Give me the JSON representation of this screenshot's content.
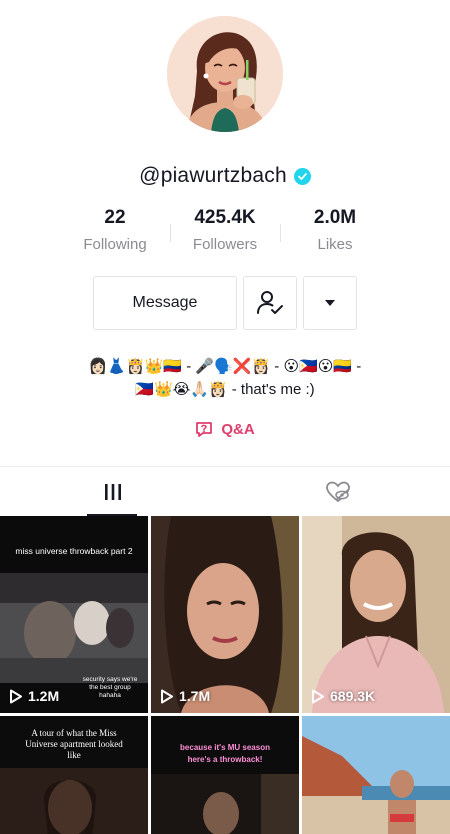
{
  "profile": {
    "username": "@piawurtzbach",
    "verified": true,
    "stats": [
      {
        "value": "22",
        "label": "Following"
      },
      {
        "value": "425.4K",
        "label": "Followers"
      },
      {
        "value": "2.0M",
        "label": "Likes"
      }
    ]
  },
  "actions": {
    "message_label": "Message"
  },
  "bio": {
    "line1": "👩🏻👗👸🏻👑🇨🇴 - 🎤🗣️❌👸🏻 - 😮🇵🇭😮🇨🇴 -",
    "line2": "🇵🇭👑😭🙏🏻👸🏻 - that's me :)"
  },
  "qa_label": "Q&A",
  "tabs": [
    {
      "icon": "grid-icon",
      "active": true
    },
    {
      "icon": "liked-hidden-icon",
      "active": false
    }
  ],
  "videos": [
    {
      "views": "1.2M",
      "caption_top": "miss universe throwback part 2",
      "caption_bottom": "security says we're the best group hahaha"
    },
    {
      "views": "1.7M"
    },
    {
      "views": "689.3K"
    },
    {
      "caption_top": "A tour of what the Miss Universe apartment looked like"
    },
    {
      "caption_top": "because it's MU season here's a throwback!"
    },
    {}
  ],
  "colors": {
    "accent": "#e03e6d",
    "verified": "#20d5ec",
    "text": "#161823",
    "muted": "#8a8b91"
  }
}
